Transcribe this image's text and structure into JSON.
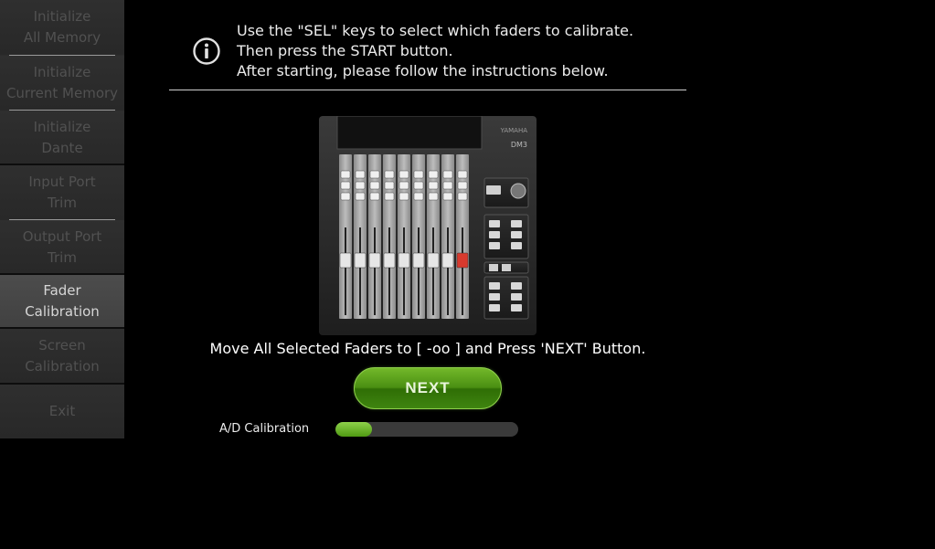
{
  "sidebar": {
    "items": [
      {
        "label": "Initialize\nAll Memory",
        "active": false
      },
      {
        "label": "Initialize\nCurrent Memory",
        "active": false
      },
      {
        "label": "Initialize\nDante",
        "active": false
      },
      {
        "label": "Input Port\nTrim",
        "active": false
      },
      {
        "label": "Output Port\nTrim",
        "active": false
      },
      {
        "label": "Fader\nCalibration",
        "active": true
      },
      {
        "label": "Screen\nCalibration",
        "active": false
      },
      {
        "label": "Exit",
        "active": false
      }
    ]
  },
  "instructions": {
    "line1": "Use the \"SEL\" keys to select which faders to calibrate.",
    "line2": "Then press the START button.",
    "line3": "After starting, please follow the instructions below."
  },
  "console": {
    "brand": "YAMAHA",
    "model": "DM3",
    "fader_count": 9,
    "highlight_fader": 9
  },
  "prompt": "Move All Selected Faders to  [ -oo ]  and Press 'NEXT' Button.",
  "next_button": {
    "label": "NEXT"
  },
  "progress": {
    "label": "A/D Calibration",
    "fraction": 0.2
  },
  "colors": {
    "accent_green": "#4a8f12",
    "fader_red": "#d83a2e"
  }
}
